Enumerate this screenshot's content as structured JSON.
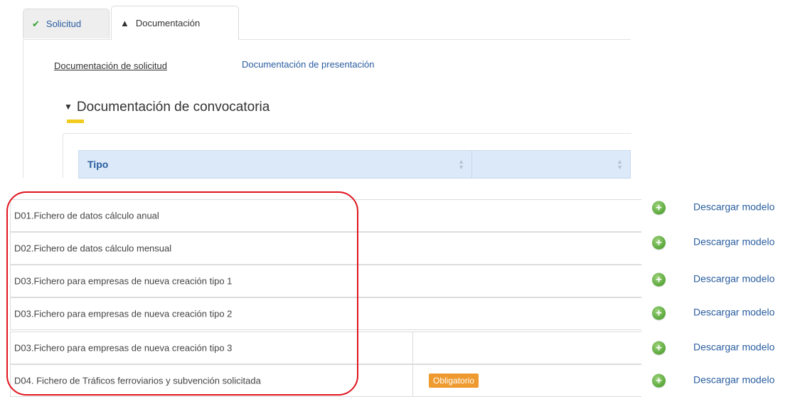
{
  "tabs": [
    {
      "label": "Solicitud",
      "icon": "check-icon"
    },
    {
      "label": "Documentación",
      "icon": "warning-icon"
    }
  ],
  "subtabs": {
    "active": "Documentación de solicitud",
    "other": "Documentación de presentación"
  },
  "section": {
    "title": "Documentación de convocatoria",
    "accent_color": "#f2cb1d"
  },
  "table": {
    "column_tipo": "Tipo",
    "column_2": ""
  },
  "rows": [
    {
      "label": "D01.Fichero de datos cálculo anual",
      "badge": "",
      "action": "Descargar modelo"
    },
    {
      "label": "D02.Fichero de datos cálculo mensual",
      "badge": "",
      "action": "Descargar modelo"
    },
    {
      "label": "D03.Fichero para empresas de nueva creación tipo 1",
      "badge": "",
      "action": "Descargar modelo"
    },
    {
      "label": "D03.Fichero para empresas de nueva creación tipo 2",
      "badge": "",
      "action": "Descargar modelo"
    },
    {
      "label": "D03.Fichero para empresas de nueva creación tipo 3",
      "badge": "",
      "action": "Descargar modelo"
    },
    {
      "label": "D04. Fichero de Tráficos ferroviarios y subvención solicitada",
      "badge": "Obligatorio",
      "action": "Descargar modelo"
    }
  ],
  "colors": {
    "link": "#2a5d9f",
    "badge": "#ee9a2e",
    "add_icon": "#58a73a",
    "highlight_outline": "#e0141e"
  }
}
